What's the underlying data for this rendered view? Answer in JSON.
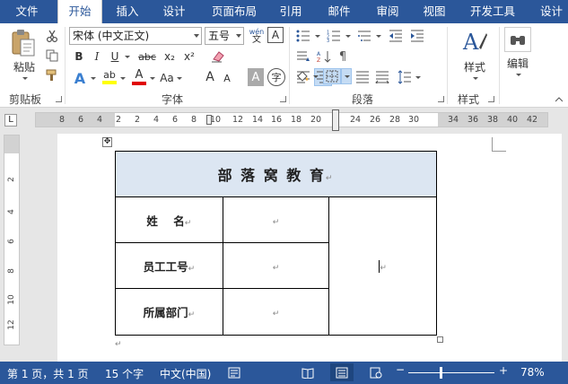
{
  "tabs": [
    "文件",
    "开始",
    "插入",
    "设计",
    "页面布局",
    "引用",
    "邮件",
    "审阅",
    "视图",
    "开发工具",
    "设计"
  ],
  "active_tab": "开始",
  "ribbon": {
    "clipboard": {
      "paste_label": "粘贴",
      "group_label": "剪贴板"
    },
    "font": {
      "font_name": "宋体 (中文正文)",
      "font_size": "五号",
      "phonetic_label": "wén",
      "bold": "B",
      "italic": "I",
      "underline": "U",
      "strike": "abc",
      "subscript": "x₂",
      "superscript": "x²",
      "aa": "Aa",
      "grow": "A",
      "shrink": "A",
      "char_shading": "A",
      "enclosed": "字",
      "group_label": "字体"
    },
    "paragraph": {
      "group_label": "段落"
    },
    "styles": {
      "label": "样式",
      "group_label": "样式"
    },
    "editing": {
      "label": "编辑"
    }
  },
  "ruler": {
    "corner": "L",
    "ticks": [
      "8",
      "6",
      "4",
      "2",
      "2",
      "4",
      "6",
      "8",
      "10",
      "12",
      "14",
      "16",
      "18",
      "20",
      "24",
      "26",
      "28",
      "30",
      "34",
      "36",
      "38",
      "40",
      "42"
    ],
    "vticks": [
      "2",
      "4",
      "6",
      "8",
      "10",
      "12"
    ]
  },
  "document": {
    "title": "部 落 窝 教 育",
    "rows": [
      {
        "label": "姓    名",
        "value": ""
      },
      {
        "label": "员工工号",
        "value": ""
      },
      {
        "label": "所属部门",
        "value": ""
      }
    ],
    "paragraph_mark": "↵",
    "cell_mark": "↵"
  },
  "status": {
    "page_info": "第 1 页，共 1 页",
    "word_count": "15 个字",
    "language": "中文(中国)",
    "zoom": "78%",
    "minus": "−",
    "plus": "+"
  },
  "colors": {
    "accent": "#2b579a",
    "title_fill": "#dce6f2"
  }
}
